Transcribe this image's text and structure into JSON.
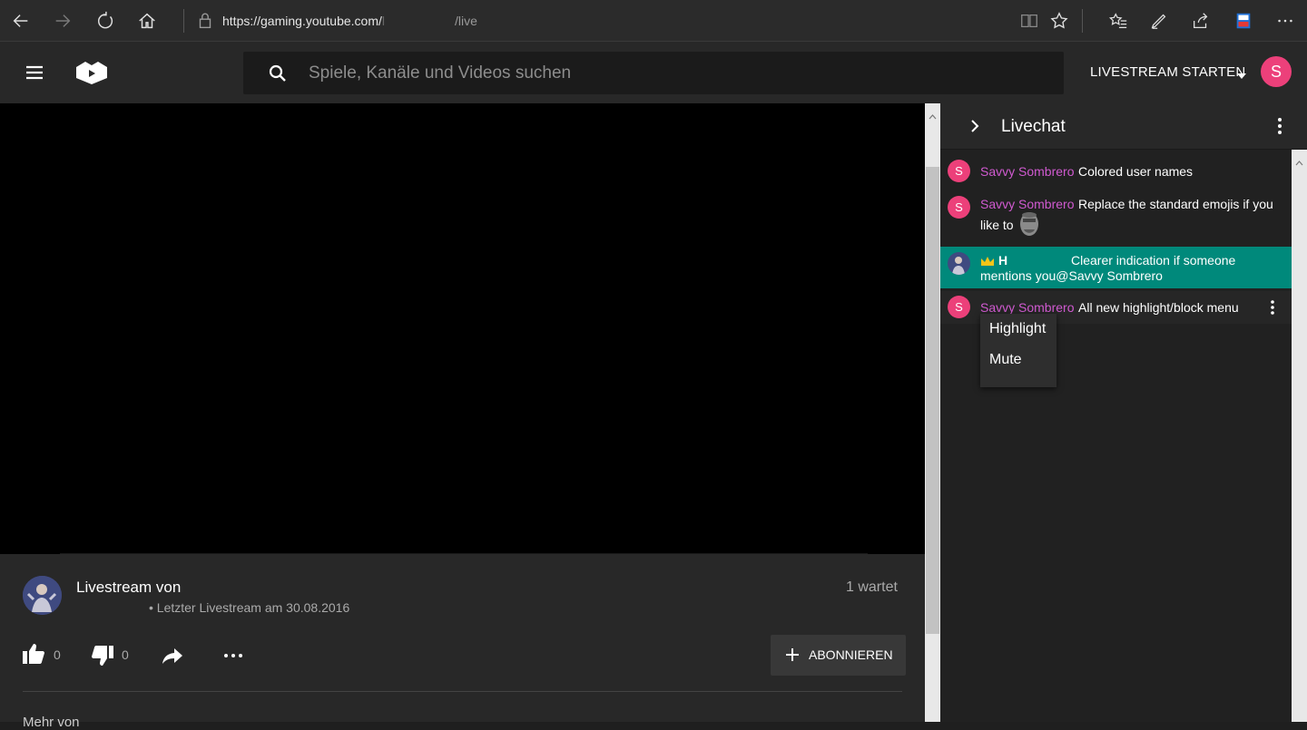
{
  "browser": {
    "url_host": "https://gaming.youtube.com/",
    "url_sep": "l",
    "url_suffix": "/live"
  },
  "header": {
    "search_placeholder": "Spiele, Kanäle und Videos suchen",
    "livestream_button": "LIVESTREAM STARTEN",
    "avatar_letter": "S"
  },
  "channel": {
    "title": "Livestream von",
    "last_stream": "• Letzter Livestream am 30.08.2016",
    "waiting": "1 wartet",
    "likes": "0",
    "dislikes": "0",
    "subscribe_label": "ABONNIEREN",
    "more_from": "Mehr von"
  },
  "chat": {
    "title": "Livechat",
    "messages": [
      {
        "avatar": "S",
        "author": "Savvy Sombrero",
        "text": "Colored user names"
      },
      {
        "avatar": "S",
        "author": "Savvy Sombrero",
        "text": "Replace the standard emojis if you",
        "text2": "like to"
      },
      {
        "author": "H",
        "text": "Clearer indication if someone",
        "text2": "mentions you@Savvy Sombrero"
      },
      {
        "avatar": "S",
        "author": "Savvy Sombrero",
        "text": "All new highlight/block menu"
      }
    ],
    "menu": {
      "highlight": "Highlight",
      "mute": "Mute"
    }
  },
  "colors": {
    "accent": "#ec407a",
    "author": "#d05ad0",
    "mention_bg": "#00897b"
  }
}
